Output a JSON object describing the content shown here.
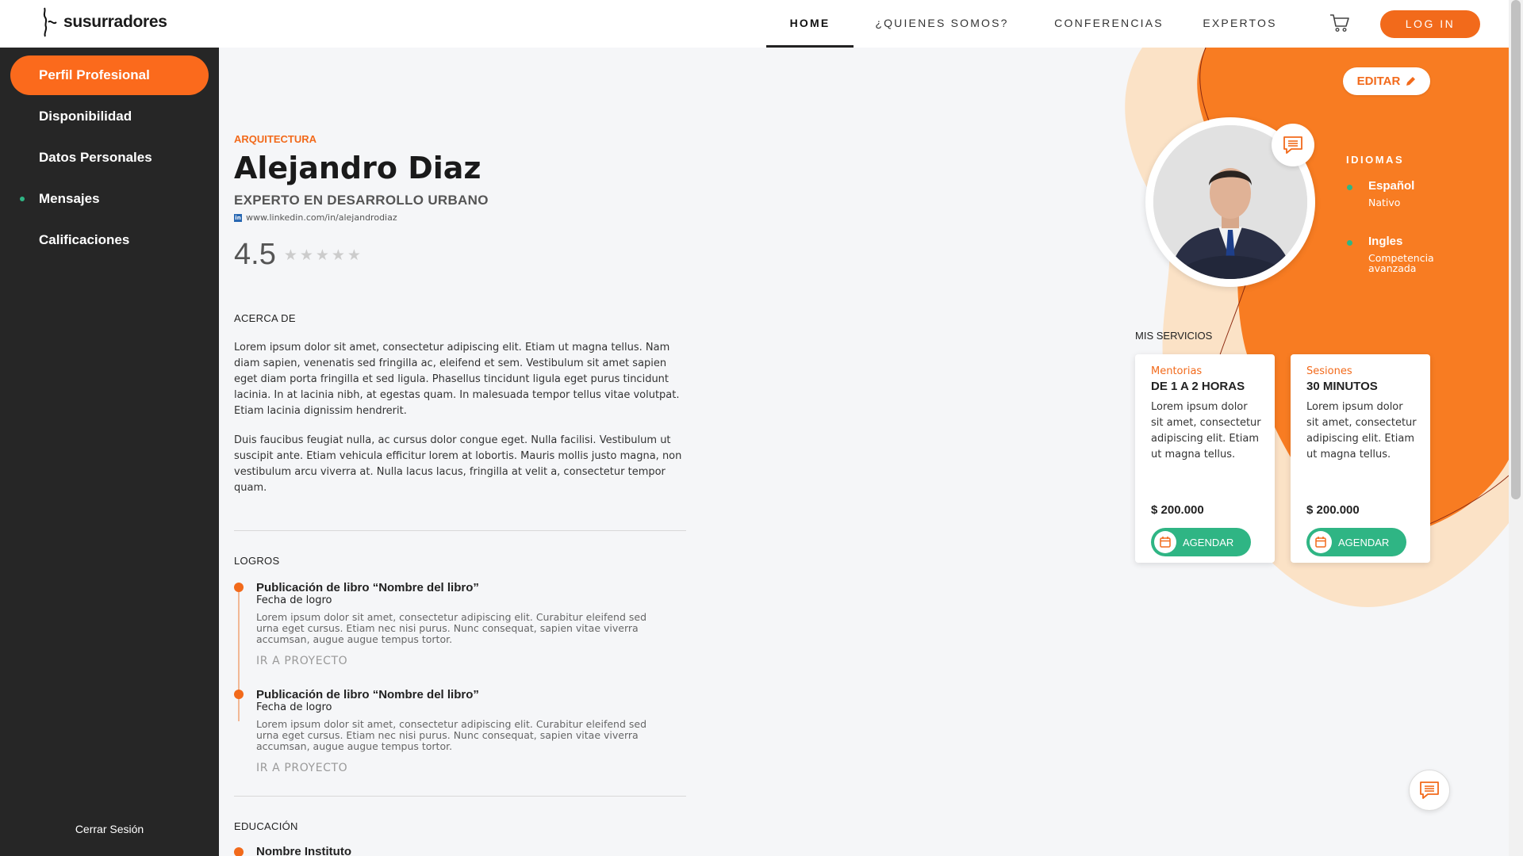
{
  "brand": {
    "name": "susurradores"
  },
  "colors": {
    "accent": "#f26a1b",
    "sidebar": "#262626",
    "success": "#2fb584"
  },
  "nav": {
    "items": [
      {
        "label": "HOME",
        "active": true
      },
      {
        "label": "¿QUIENES SOMOS?"
      },
      {
        "label": "CONFERENCIAS"
      },
      {
        "label": "EXPERTOS"
      }
    ],
    "cart_icon": "cart-icon",
    "login_label": "LOG IN"
  },
  "sidebar": {
    "items": [
      {
        "label": "Perfil Profesional",
        "active": true
      },
      {
        "label": "Disponibilidad"
      },
      {
        "label": "Datos Personales"
      },
      {
        "label": "Mensajes",
        "notification": true
      },
      {
        "label": "Calificaciones"
      }
    ],
    "logout_label": "Cerrar Sesión"
  },
  "profile": {
    "category": "ARQUITECTURA",
    "name": "Alejandro Diaz",
    "title": "EXPERTO EN DESARROLLO URBANO",
    "linkedin": "www.linkedin.com/in/alejandrodiaz",
    "rating": "4.5",
    "stars_filled": 0,
    "stars_total": 5,
    "edit_label": "EDITAR"
  },
  "about": {
    "title": "ACERCA DE",
    "paragraphs": [
      "Lorem ipsum dolor sit amet, consectetur adipiscing elit. Etiam ut magna tellus. Nam diam sapien, venenatis sed fringilla ac, eleifend et sem. Vestibulum sit amet sapien eget diam porta fringilla et sed ligula. Phasellus tincidunt ligula eget purus tincidunt lacinia. In at lacinia nibh, at egestas quam. In malesuada tempor tellus vitae volutpat. Etiam lacinia dignissim hendrerit.",
      "Duis faucibus feugiat nulla, ac cursus dolor congue eget. Nulla facilisi. Vestibulum ut suscipit ante. Etiam vehicula efficitur lorem at lobortis. Mauris mollis justo magna, non vestibulum arcu viverra at. Nulla lacus lacus, fringilla at velit a, consectetur tempor quam."
    ]
  },
  "achievements": {
    "title": "LOGROS",
    "items": [
      {
        "title": "Publicación de libro “Nombre del libro”",
        "date": "Fecha de logro",
        "text": "Lorem ipsum dolor sit amet, consectetur adipiscing elit. Curabitur eleifend sed urna eget cursus. Etiam nec nisi purus. Nunc consequat, sapien vitae viverra accumsan, augue augue tempus tortor.",
        "link": "IR A PROYECTO"
      },
      {
        "title": "Publicación de libro “Nombre del libro”",
        "date": "Fecha de logro",
        "text": "Lorem ipsum dolor sit amet, consectetur adipiscing elit. Curabitur eleifend sed urna eget cursus. Etiam nec nisi purus. Nunc consequat, sapien vitae viverra accumsan, augue augue tempus tortor.",
        "link": "IR A PROYECTO"
      }
    ]
  },
  "education": {
    "title": "EDUCACIÓN",
    "items": [
      {
        "title": "Nombre Instituto"
      }
    ]
  },
  "languages": {
    "title": "IDIOMAS",
    "items": [
      {
        "name": "Español",
        "level": "Nativo"
      },
      {
        "name": "Ingles",
        "level": "Competencia avanzada"
      }
    ]
  },
  "services": {
    "title": "MIS SERVICIOS",
    "items": [
      {
        "kind": "Mentorias",
        "duration": "DE 1 A 2 HORAS",
        "description": "Lorem ipsum dolor sit amet, consectetur adipiscing elit. Etiam ut magna tellus.",
        "price": "$ 200.000",
        "button": "AGENDAR"
      },
      {
        "kind": "Sesiones",
        "duration": "30 MINUTOS",
        "description": "Lorem ipsum dolor sit amet, consectetur adipiscing elit. Etiam ut magna tellus.",
        "price": "$ 200.000",
        "button": "AGENDAR"
      }
    ]
  }
}
